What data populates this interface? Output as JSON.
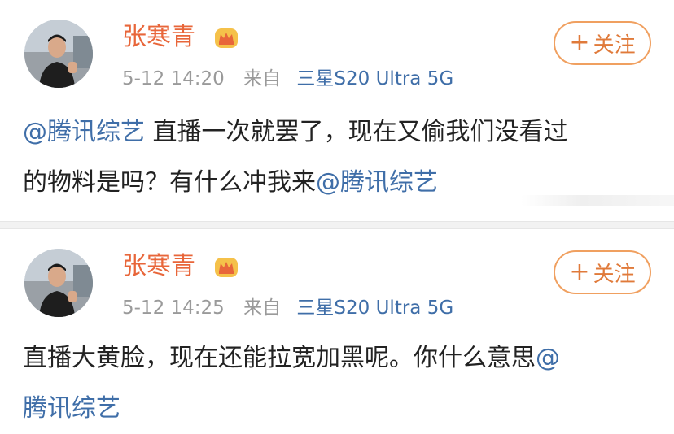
{
  "posts": [
    {
      "username": "张寒青",
      "time": "5-12 14:20",
      "from_label": "来自",
      "device": "三星S20 Ultra 5G",
      "follow_plus": "+",
      "follow_label": "关注",
      "line1_mention": "@腾讯综艺",
      "line1_text": " 直播一次就罢了，现在又偷我们没看过",
      "line2_text": "的物料是吗？有什么冲我来",
      "line2_mention": "@腾讯综艺"
    },
    {
      "username": "张寒青",
      "time": "5-12 14:25",
      "from_label": "来自",
      "device": "三星S20 Ultra 5G",
      "follow_plus": "+",
      "follow_label": "关注",
      "line1_text": "直播大黄脸，现在还能拉宽加黑呢。你什么意思",
      "line1_mention": "@",
      "line2_mention": "腾讯综艺"
    }
  ],
  "colors": {
    "username": "#e8663a",
    "mention": "#3f6ea8",
    "device": "#3f6ea8",
    "meta": "#9a9a9a",
    "follow_border": "#f0a060"
  },
  "icons": {
    "vip": "crown-badge-icon",
    "avatar": "user-photo"
  }
}
